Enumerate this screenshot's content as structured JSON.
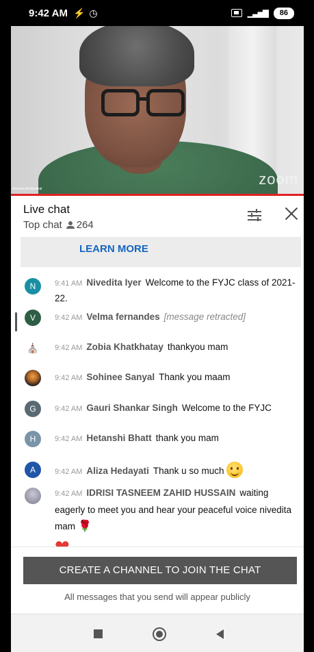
{
  "status_bar": {
    "time": "9:42 AM",
    "battery": "86",
    "signal": "4G"
  },
  "video": {
    "brand": "zoom",
    "participant_name": "Anatola Amritmahal"
  },
  "chat_header": {
    "title": "Live chat",
    "mode": "Top chat",
    "viewers": "264"
  },
  "learn_more": "LEARN MORE",
  "messages": [
    {
      "avatar": "N",
      "avatar_color": "#1a8fa3",
      "time": "9:41 AM",
      "author": "Nivedita Iyer",
      "text": "Welcome to the FYJC class of 2021-22."
    },
    {
      "avatar": "V",
      "avatar_color": "#2e5e45",
      "time": "9:42 AM",
      "author": "Velma fernandes",
      "text": "[message retracted]"
    },
    {
      "avatar": "",
      "avatar_color": "#ffffff",
      "time": "9:42 AM",
      "author": "Zobia Khatkhatay",
      "text": "thankyou mam"
    },
    {
      "avatar": "",
      "avatar_color": "#3b2e25",
      "time": "9:42 AM",
      "author": "Sohinee Sanyal",
      "text": "Thank you maam"
    },
    {
      "avatar": "G",
      "avatar_color": "#5a6a73",
      "time": "9:42 AM",
      "author": "Gauri Shankar Singh",
      "text": "Welcome to the FYJC"
    },
    {
      "avatar": "H",
      "avatar_color": "#7a94a8",
      "time": "9:42 AM",
      "author": "Hetanshi Bhatt",
      "text": "thank you mam"
    },
    {
      "avatar": "A",
      "avatar_color": "#1f56a8",
      "time": "9:42 AM",
      "author": "Aliza Hedayati",
      "text": "Thank u so much"
    },
    {
      "avatar": "",
      "avatar_color": "#8a8a9a",
      "time": "9:42 AM",
      "author": "IDRISI TASNEEM ZAHID HUSSAIN",
      "text": "waiting eagerly to meet you and hear your peaceful voice nivedita mam"
    }
  ],
  "footer": {
    "create_channel": "CREATE A CHANNEL TO JOIN THE CHAT",
    "public_note": "All messages that you send will appear publicly"
  },
  "icons": {
    "filter": "filter-sliders-icon",
    "close": "close-icon",
    "viewers": "person-icon",
    "smiley": "smiley-emoji",
    "rose": "rose-emoji",
    "heart": "heart-emoji"
  }
}
